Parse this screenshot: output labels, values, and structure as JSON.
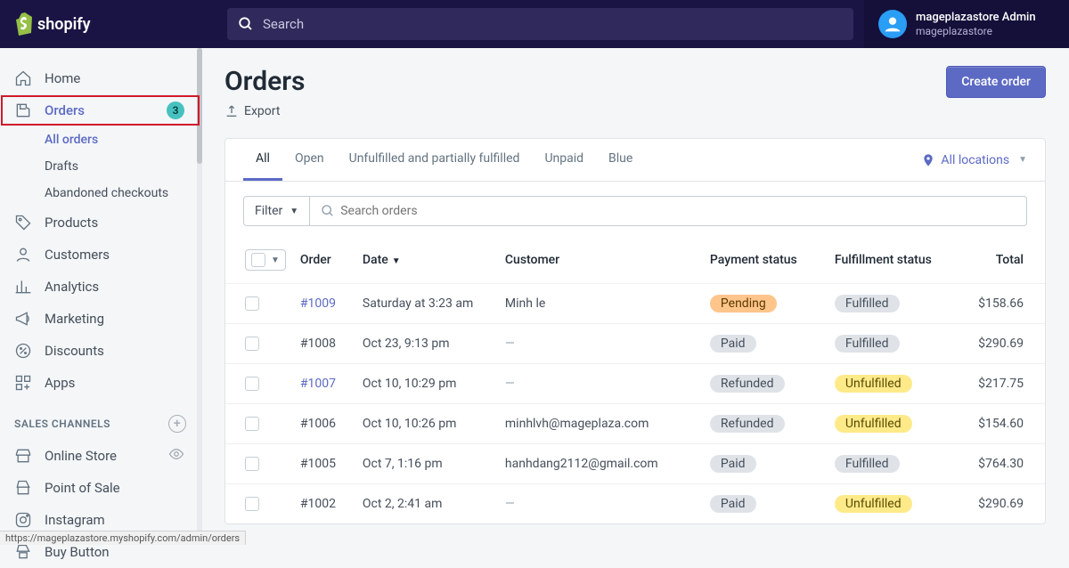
{
  "topbar": {
    "search_placeholder": "Search",
    "user_name": "mageplazastore Admin",
    "user_store": "mageplazastore"
  },
  "sidebar": {
    "home": "Home",
    "orders": "Orders",
    "orders_badge": "3",
    "sub": {
      "all_orders": "All orders",
      "drafts": "Drafts",
      "abandoned": "Abandoned checkouts"
    },
    "products": "Products",
    "customers": "Customers",
    "analytics": "Analytics",
    "marketing": "Marketing",
    "discounts": "Discounts",
    "apps": "Apps",
    "section_channels": "SALES CHANNELS",
    "online_store": "Online Store",
    "point_of_sale": "Point of Sale",
    "instagram": "Instagram",
    "buy_button": "Buy Button"
  },
  "page": {
    "title": "Orders",
    "export": "Export",
    "create_order": "Create order",
    "tabs": {
      "all": "All",
      "open": "Open",
      "unfulfilled": "Unfulfilled and partially fulfilled",
      "unpaid": "Unpaid",
      "blue": "Blue"
    },
    "all_locations": "All locations",
    "filter": "Filter",
    "search_orders_placeholder": "Search orders",
    "columns": {
      "order": "Order",
      "date": "Date",
      "customer": "Customer",
      "payment": "Payment status",
      "fulfillment": "Fulfillment status",
      "total": "Total"
    }
  },
  "orders": [
    {
      "id": "#1009",
      "link": true,
      "date": "Saturday at 3:23 am",
      "customer": "Minh le",
      "payment": "Pending",
      "payment_style": "orange",
      "fulfillment": "Fulfilled",
      "fulfillment_style": "grey",
      "total": "$158.66"
    },
    {
      "id": "#1008",
      "link": false,
      "date": "Oct 23, 9:13 pm",
      "customer": "—",
      "payment": "Paid",
      "payment_style": "grey",
      "fulfillment": "Fulfilled",
      "fulfillment_style": "grey",
      "total": "$290.69"
    },
    {
      "id": "#1007",
      "link": true,
      "date": "Oct 10, 10:29 pm",
      "customer": "—",
      "payment": "Refunded",
      "payment_style": "grey",
      "fulfillment": "Unfulfilled",
      "fulfillment_style": "yellow",
      "total": "$217.75"
    },
    {
      "id": "#1006",
      "link": false,
      "date": "Oct 10, 10:26 pm",
      "customer": "minhlvh@mageplaza.com",
      "payment": "Refunded",
      "payment_style": "grey",
      "fulfillment": "Unfulfilled",
      "fulfillment_style": "yellow",
      "total": "$154.60"
    },
    {
      "id": "#1005",
      "link": false,
      "date": "Oct 7, 1:16 pm",
      "customer": "hanhdang2112@gmail.com",
      "payment": "Paid",
      "payment_style": "grey",
      "fulfillment": "Fulfilled",
      "fulfillment_style": "grey",
      "total": "$764.30"
    },
    {
      "id": "#1002",
      "link": false,
      "date": "Oct 2, 2:41 am",
      "customer": "—",
      "payment": "Paid",
      "payment_style": "grey",
      "fulfillment": "Unfulfilled",
      "fulfillment_style": "yellow",
      "total": "$290.69"
    }
  ],
  "status_url": "https://mageplazastore.myshopify.com/admin/orders"
}
